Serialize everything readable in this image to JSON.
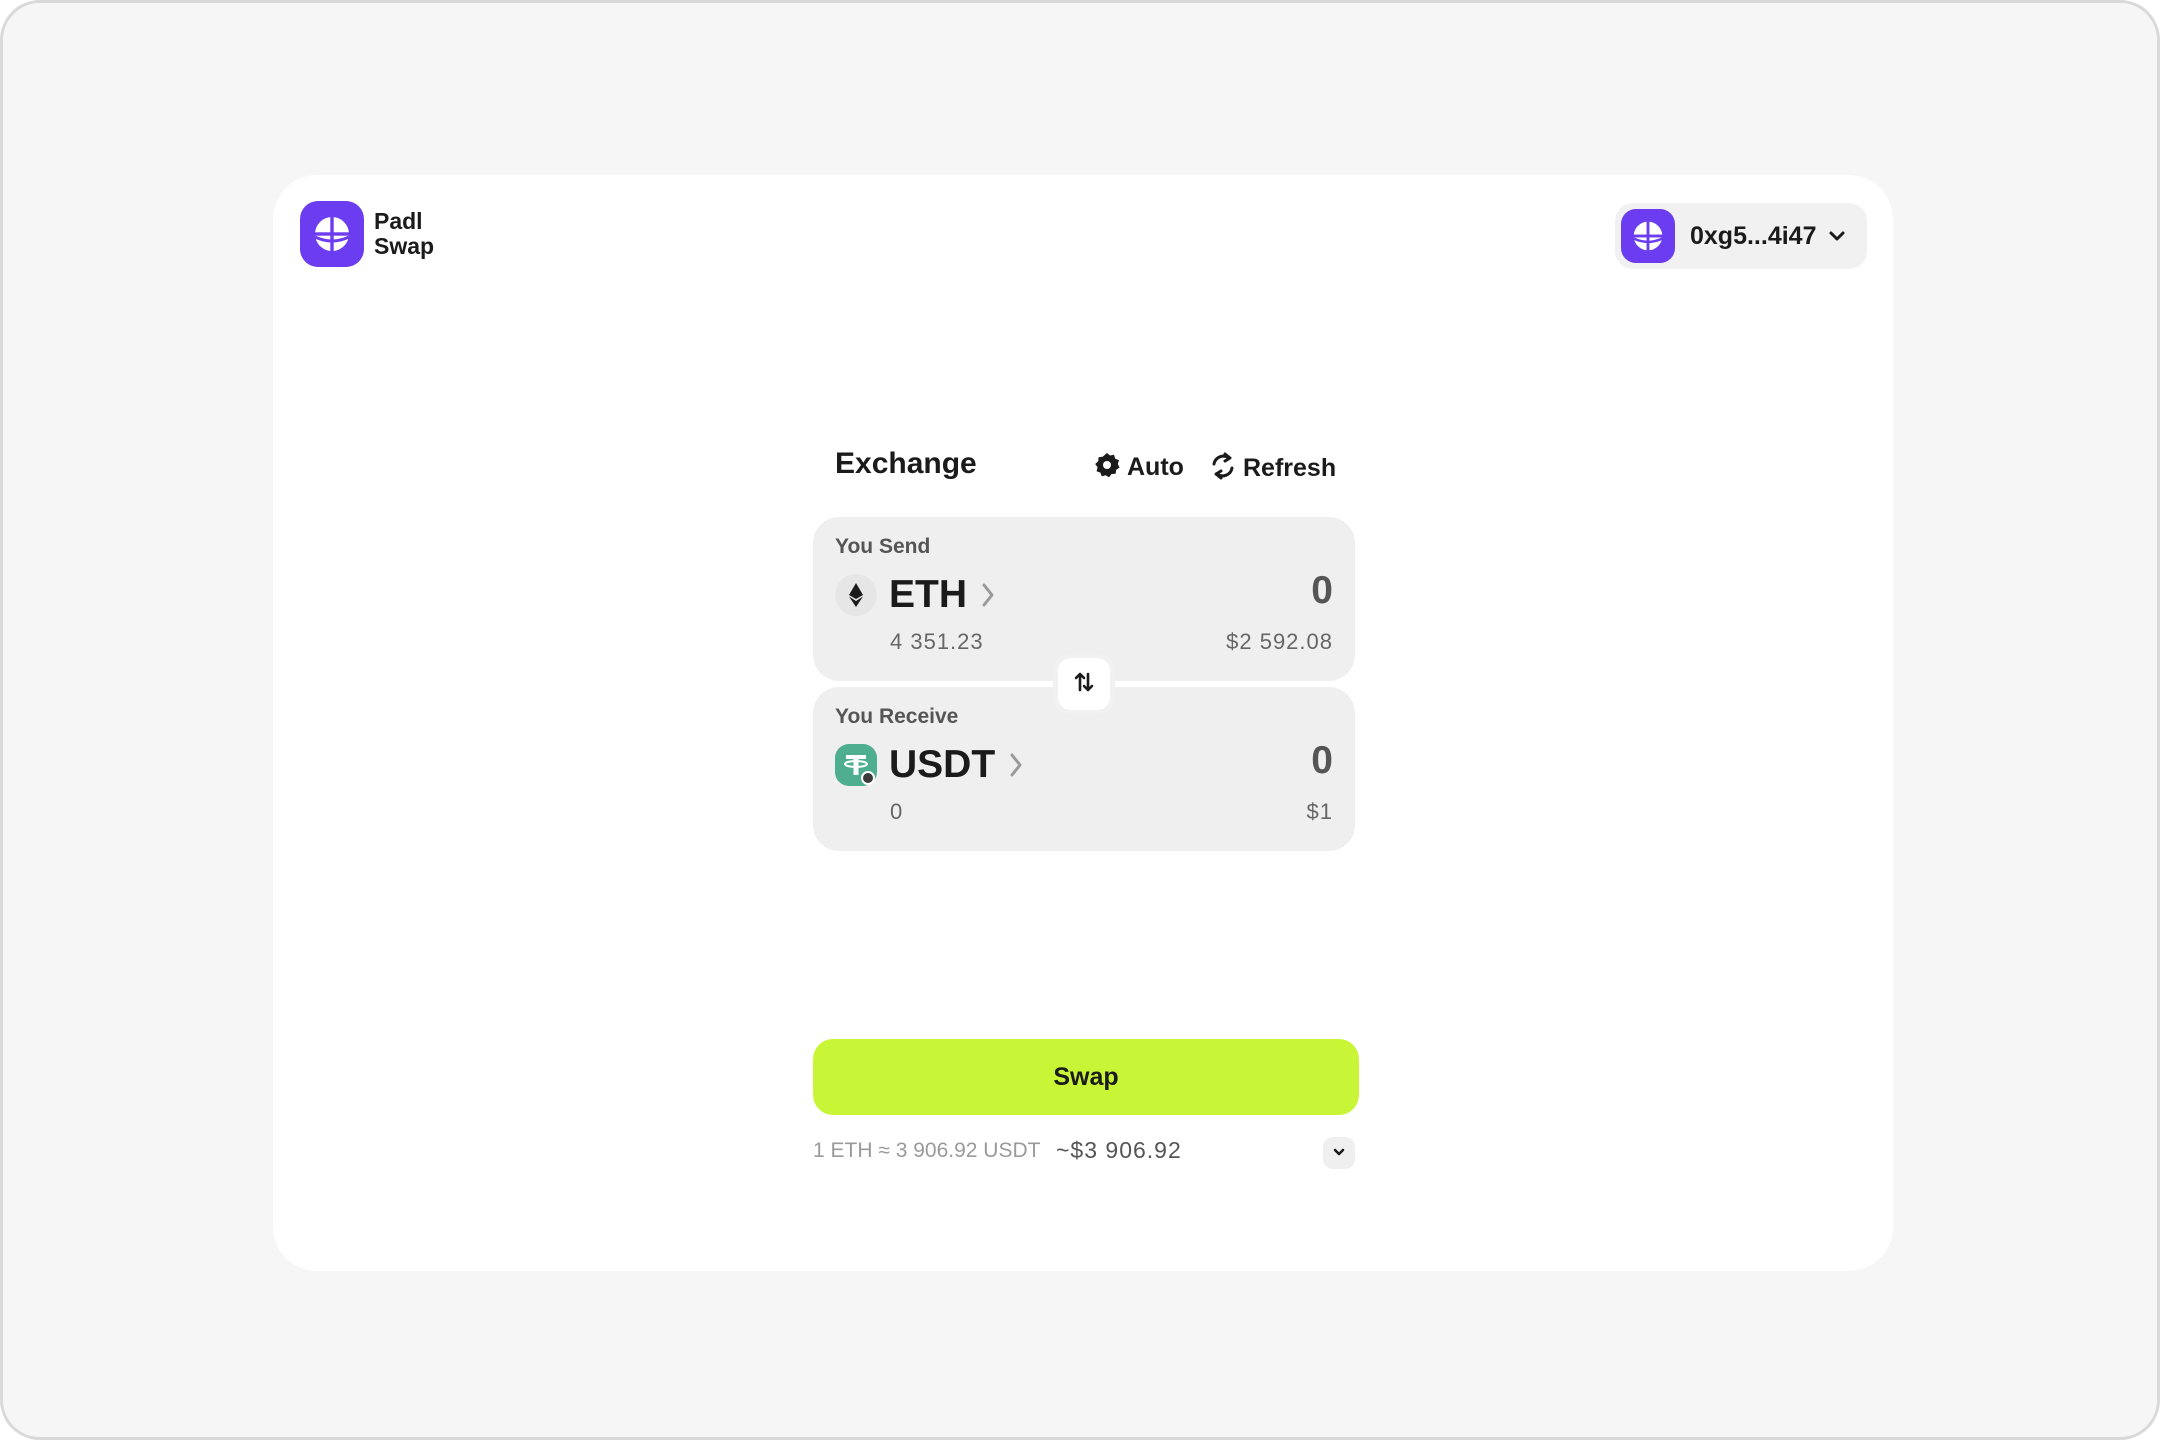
{
  "brand": {
    "line1": "Padl",
    "line2": "Swap",
    "logo_icon": "globe-icon",
    "color": "#6b3cf0"
  },
  "wallet": {
    "address": "0xg5...4i47",
    "avatar_icon": "globe-icon",
    "chevron_icon": "chevron-down-icon"
  },
  "exchange": {
    "title": "Exchange",
    "auto_label": "Auto",
    "auto_icon": "gear-icon",
    "refresh_label": "Refresh",
    "refresh_icon": "refresh-icon",
    "send": {
      "label": "You Send",
      "token": "ETH",
      "token_icon": "ethereum-icon",
      "amount": "0",
      "balance": "4 351.23",
      "fiat": "$2 592.08"
    },
    "switch_icon": "swap-arrows-icon",
    "receive": {
      "label": "You Receive",
      "token": "USDT",
      "token_icon": "tether-icon",
      "amount": "0",
      "balance": "0",
      "fiat": "$1"
    },
    "swap_label": "Swap",
    "swap_color": "#c8f535",
    "rate": "1 ETH ≈ 3 906.92 USDT",
    "rate_fiat": "~$3 906.92"
  }
}
